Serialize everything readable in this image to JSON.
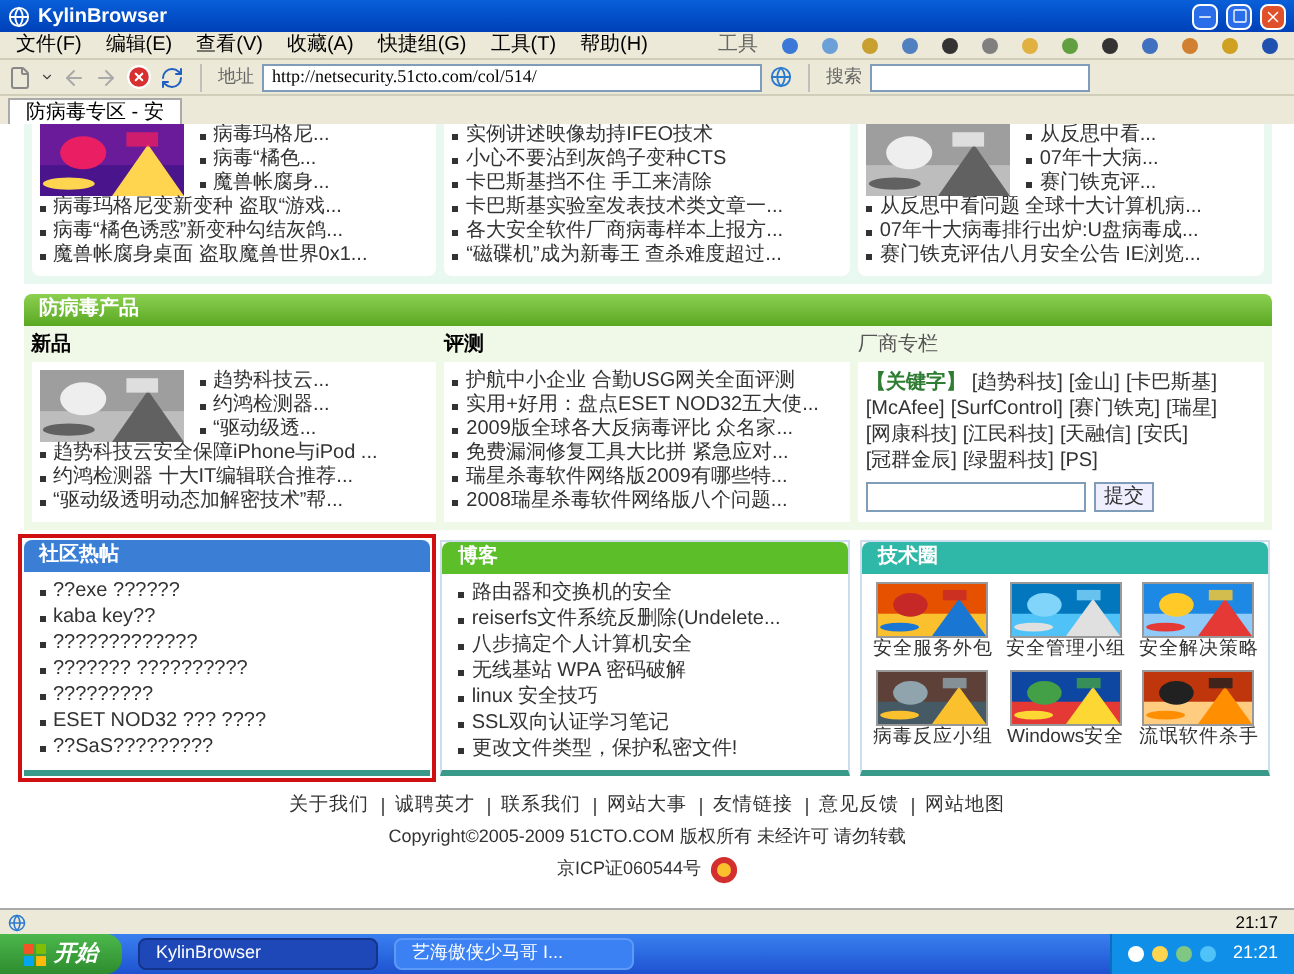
{
  "window": {
    "title": "KylinBrowser"
  },
  "menu": [
    "文件(F)",
    "编辑(E)",
    "查看(V)",
    "收藏(A)",
    "快捷组(G)",
    "工具(T)",
    "帮助(H)"
  ],
  "tools_label": "工具",
  "address": {
    "label": "地址",
    "value": "http://netsecurity.51cto.com/col/514/"
  },
  "search": {
    "label": "搜索"
  },
  "tabs": [
    {
      "label": "防病毒专区 - 安",
      "selected": true
    }
  ],
  "top_cards": [
    {
      "kind": "picture-list",
      "side_items": [
        "病毒玛格尼...",
        "病毒“橘色...",
        "魔兽帐腐身..."
      ],
      "items": [
        "病毒玛格尼变新变种  盗取“游戏...",
        "病毒“橘色诱惑”新变种勾结灰鸽...",
        "魔兽帐腐身桌面  盗取魔兽世界0x1..."
      ]
    },
    {
      "kind": "list",
      "items": [
        "实例讲述映像劫持IFEO技术",
        "小心不要沾到灰鸽子变种CTS",
        "卡巴斯基挡不住  手工来清除",
        "卡巴斯基实验室发表技术类文章一...",
        "各大安全软件厂商病毒样本上报方...",
        "“磁碟机”成为新毒王  查杀难度超过..."
      ]
    },
    {
      "kind": "picture-list",
      "side_items": [
        "从反思中看...",
        "07年十大病...",
        "赛门铁克评..."
      ],
      "items": [
        "从反思中看问题  全球十大计算机病...",
        "07年十大病毒排行出炉:U盘病毒成...",
        "赛门铁克评估八月安全公告  IE浏览..."
      ]
    }
  ],
  "products": {
    "title": "防病毒产品",
    "columns": [
      {
        "kind": "picture-list",
        "heading": "新品",
        "side_items": [
          "趋势科技云...",
          "约鸿检测器...",
          "“驱动级透..."
        ],
        "items": [
          "趋势科技云安全保障iPhone与iPod ...",
          "约鸿检测器  十大IT编辑联合推荐...",
          "“驱动级透明动态加解密技术”帮..."
        ]
      },
      {
        "kind": "list",
        "heading": "评测",
        "items": [
          "护航中小企业  合勤USG网关全面评测",
          "实用+好用：盘点ESET NOD32五大使...",
          "2009版全球各大反病毒评比  众名家...",
          "免费漏洞修复工具大比拼  紧急应对...",
          "瑞星杀毒软件网络版2009有哪些特...",
          "2008瑞星杀毒软件网络版八个问题..."
        ]
      },
      {
        "kind": "vendor",
        "heading": "厂商专栏",
        "keyword_label": "【关键字】",
        "keywords": [
          "[趋势科技]",
          "[金山]",
          "[卡巴斯基]",
          "[McAfee]",
          "[SurfControl]",
          "[赛门铁克]",
          "[瑞星]",
          "[网康科技]",
          "[江民科技]",
          "[天融信]",
          "[安氏]",
          "[冠群金辰]",
          "[绿盟科技]",
          "[PS]"
        ],
        "button": "提交"
      }
    ]
  },
  "boxes": [
    {
      "kind": "posts",
      "title": "社区热帖",
      "color": "#3a7fd5",
      "highlighted": true,
      "items": [
        "??exe ??????",
        "kaba key??",
        "?????????????",
        "??????? ??????????",
        "?????????",
        "ESET NOD32 ??? ????",
        "??SaS?????????"
      ]
    },
    {
      "kind": "posts",
      "title": "博客",
      "color": "#5cbf2a",
      "highlighted": false,
      "items": [
        "路由器和交换机的安全",
        "reiserfs文件系统反删除(Undelete...",
        "八步搞定个人计算机安全",
        "无线基站 WPA 密码破解",
        "linux 安全技巧",
        "SSL双向认证学习笔记",
        "更改文件类型，保护私密文件!"
      ]
    },
    {
      "kind": "gallery",
      "title": "技术圈",
      "color": "#2fb8a8",
      "highlighted": false,
      "items": [
        "安全服务外包",
        "安全管理小组",
        "安全解决策略",
        "病毒反应小组",
        "Windows安全",
        "流氓软件杀手"
      ]
    }
  ],
  "footer": {
    "links": [
      "关于我们",
      "诚聘英才",
      "联系我们",
      "网站大事",
      "友情链接",
      "意见反馈",
      "网站地图"
    ],
    "copyright": "Copyright©2005-2009 51CTO.COM 版权所有 未经许可 请勿转载",
    "icp": "京ICP证060544号"
  },
  "status_bar": {
    "clock": "21:17"
  },
  "taskbar": {
    "start": "开始",
    "tasks": [
      {
        "label": "KylinBrowser",
        "selected": true
      },
      {
        "label": "艺海傲侠少马哥 I...",
        "selected": false
      }
    ],
    "clock": "21:21"
  }
}
